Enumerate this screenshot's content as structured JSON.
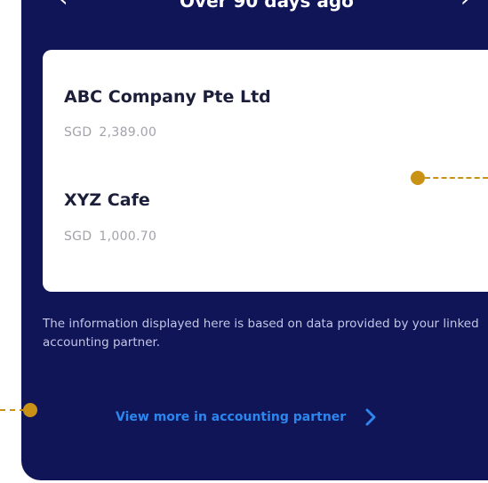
{
  "header": {
    "title": "Over 90 days ago"
  },
  "entries": [
    {
      "name": "ABC Company Pte Ltd",
      "currency": "SGD",
      "amount": "2,389.00"
    },
    {
      "name": "XYZ Cafe",
      "currency": "SGD",
      "amount": "1,000.70"
    }
  ],
  "disclaimer": "The information displayed here is based on data provided by your linked accounting partner.",
  "view_more": {
    "label": "View more in accounting partner",
    "icon": "chevron-right-icon"
  },
  "colors": {
    "panel": "#0f1556",
    "link": "#2d86ee",
    "marker": "#c99216"
  }
}
